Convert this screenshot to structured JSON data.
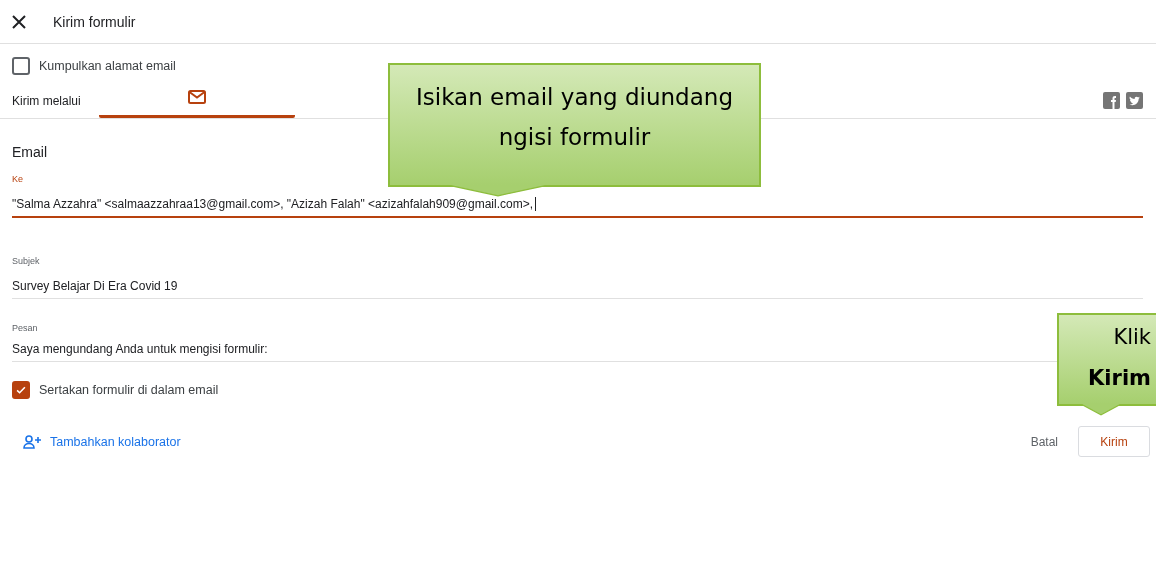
{
  "window": {
    "title": "Kirim formulir"
  },
  "collect_emails": {
    "label": "Kumpulkan alamat email",
    "checked": false
  },
  "send_via": {
    "label": "Kirim melalui",
    "tabs": [
      {
        "kind": "email",
        "selected": true
      }
    ]
  },
  "section_title": "Email",
  "fields": [
    {
      "label": "Ke",
      "value": "\"Salma Azzahra\" <salmaazzahraa13@gmail.com>, \"Azizah Falah\" <azizahfalah909@gmail.com>,",
      "focused": true
    },
    {
      "label": "Subjek",
      "value": "Survey Belajar Di Era Covid 19",
      "focused": false
    },
    {
      "label": "Pesan",
      "value": "Saya mengundang Anda untuk mengisi formulir:",
      "focused": false
    }
  ],
  "include_form": {
    "label": "Sertakan formulir di dalam email",
    "checked": true
  },
  "add_collaborator": "Tambahkan kolaborator",
  "buttons": [
    {
      "label": "Batal",
      "kind": "text"
    },
    {
      "label": "Kirim",
      "kind": "outlined"
    }
  ],
  "callouts": [
    {
      "lines": [
        {
          "text": "Isikan email yang diundang",
          "bold": false
        },
        {
          "text": "ngisi formulir",
          "bold": false
        }
      ]
    },
    {
      "lines": [
        {
          "text": "Klik",
          "bold": false
        },
        {
          "text": "Kirim",
          "bold": true
        }
      ]
    }
  ]
}
